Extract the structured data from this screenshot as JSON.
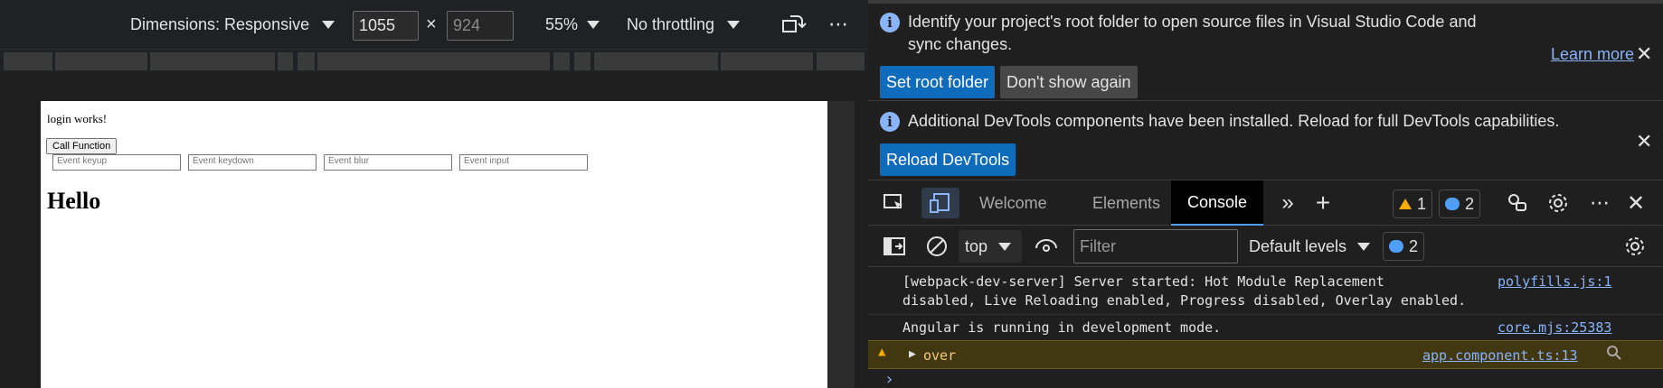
{
  "device_toolbar": {
    "dimensions_label": "Dimensions: Responsive",
    "width_value": "1055",
    "times_symbol": "×",
    "height_placeholder": "924",
    "zoom": "55%",
    "throttling": "No throttling",
    "more_icon": "⋯"
  },
  "viewport": {
    "text": "login works!",
    "button_label": "Call Function",
    "fields": [
      "Event keyup",
      "Event keydown",
      "Event blur",
      "Event input"
    ],
    "heading": "Hello"
  },
  "infobar_root": {
    "message": "Identify your project's root folder to open source files in Visual Studio Code and sync changes.",
    "learn_more": "Learn more",
    "set_root": "Set root folder",
    "dont_show": "Don't show again"
  },
  "infobar_components": {
    "message": "Additional DevTools components have been installed. Reload for full DevTools capabilities.",
    "reload": "Reload DevTools"
  },
  "tabs": {
    "welcome": "Welcome",
    "elements": "Elements",
    "console": "Console",
    "warning_count": "1",
    "message_count": "2"
  },
  "console_toolbar": {
    "context": "top",
    "filter_placeholder": "Filter",
    "levels": "Default levels",
    "message_count": "2"
  },
  "logs": [
    {
      "text1": "[webpack-dev-server] Server started: Hot Module Replacement",
      "text2": "disabled, Live Reloading enabled, Progress disabled, Overlay enabled.",
      "source": "polyfills.js:1"
    },
    {
      "text": "Angular is running in development mode.",
      "source": "core.mjs:25383"
    },
    {
      "text": "over",
      "source": "app.component.ts:13",
      "level": "warning"
    }
  ],
  "prompt_symbol": "›",
  "colors": {
    "accent": "#0f6cbd",
    "link": "#8ab4f8",
    "warning": "#f9ab00",
    "warning_bg": "#413812"
  }
}
